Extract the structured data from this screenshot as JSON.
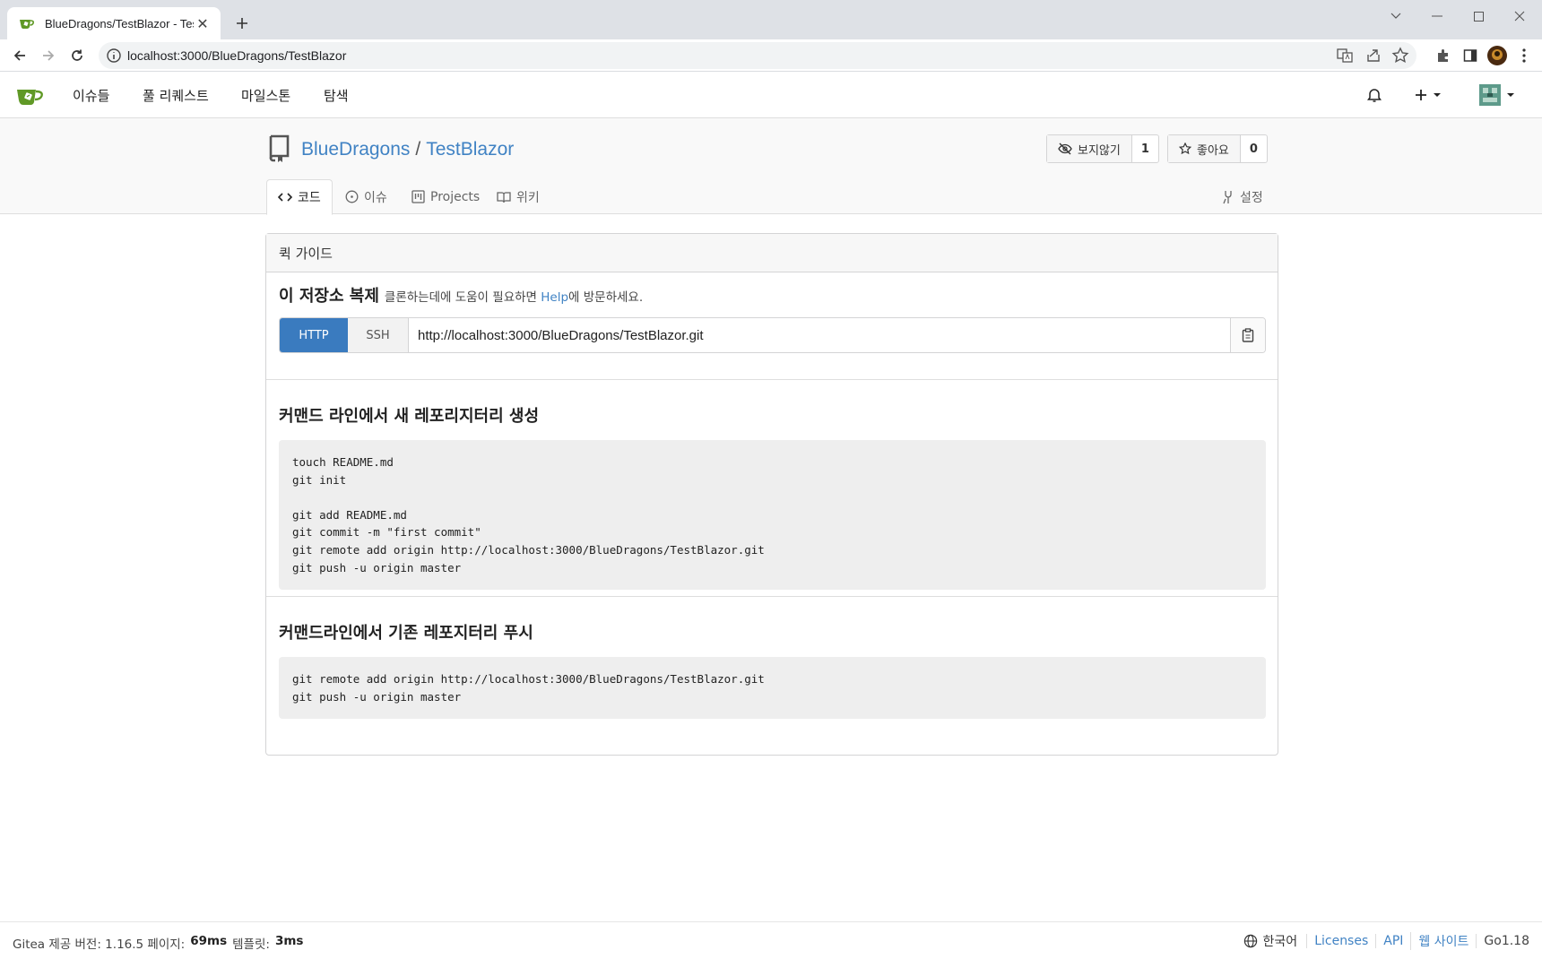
{
  "browser": {
    "tab_title": "BlueDragons/TestBlazor - TestBlazor",
    "url": "localhost:3000/BlueDragons/TestBlazor"
  },
  "nav": {
    "items": [
      "이슈들",
      "풀 리퀘스트",
      "마일스톤",
      "탐색"
    ]
  },
  "repo": {
    "owner": "BlueDragons",
    "separator": "/",
    "name": "TestBlazor",
    "watch_label": "보지않기",
    "watch_count": "1",
    "star_label": "좋아요",
    "star_count": "0",
    "tabs": {
      "code": "코드",
      "issues": "이슈",
      "projects": "Projects",
      "wiki": "위키",
      "settings": "설정"
    }
  },
  "guide": {
    "header": "퀵 가이드",
    "clone_title": "이 저장소 복제",
    "clone_hint_pre": "클론하는데에 도움이 필요하면",
    "clone_hint_link": "Help",
    "clone_hint_post": "에 방문하세요.",
    "http_label": "HTTP",
    "ssh_label": "SSH",
    "clone_url": "http://localhost:3000/BlueDragons/TestBlazor.git",
    "new_repo_title": "커맨드 라인에서 새 레포리지터리 생성",
    "new_repo_code": "touch README.md\ngit init\n\ngit add README.md\ngit commit -m \"first commit\"\ngit remote add origin http://localhost:3000/BlueDragons/TestBlazor.git\ngit push -u origin master",
    "push_title": "커맨드라인에서 기존 레포지터리 푸시",
    "push_code": "git remote add origin http://localhost:3000/BlueDragons/TestBlazor.git\ngit push -u origin master"
  },
  "footer": {
    "powered": "Gitea 제공 버전: 1.16.5 페이지:",
    "page_time": "69ms",
    "template_label": "템플릿:",
    "template_time": "3ms",
    "language": "한국어",
    "licenses": "Licenses",
    "api": "API",
    "website": "웹 사이트",
    "go_version": "Go1.18"
  },
  "colors": {
    "link": "#4183c4",
    "http_active": "#3a7bbf",
    "gitea_green": "#609926"
  }
}
